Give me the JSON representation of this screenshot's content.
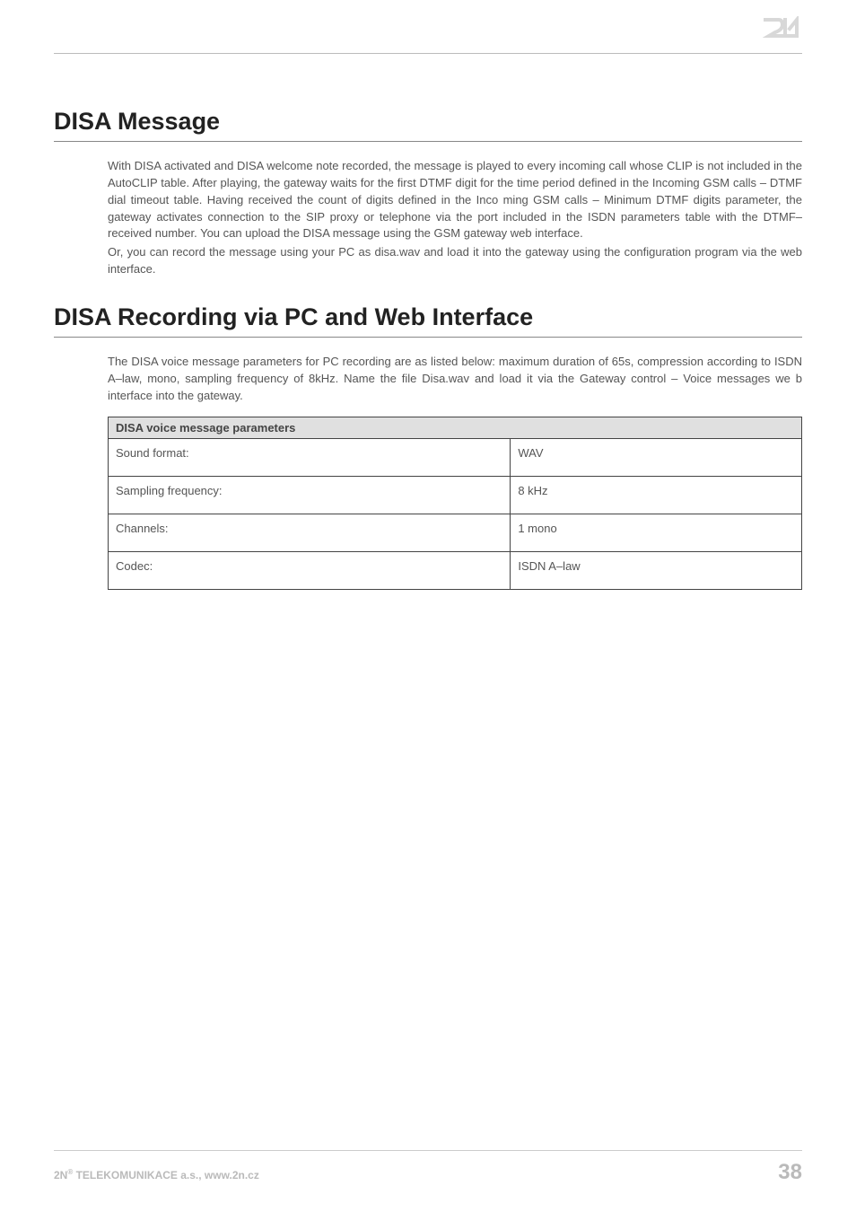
{
  "sections": {
    "disa_message": {
      "heading": "DISA Message",
      "paragraph1": "With DISA activated and DISA welcome note recorded, the message is played to every incoming call whose CLIP is not included in the AutoCLIP table. After playing, the gateway waits for the first DTMF digit for the time period defined in the Incoming GSM calls – DTMF dial timeout table. Having received the count of digits defined in the Inco ming GSM calls – Minimum DTMF digits parameter, the gateway activates connection to the SIP proxy or telephone via the port included in the ISDN parameters table with the DTMF–received number. You can upload the DISA message using the GSM gateway web interface.",
      "paragraph2": "Or, you can record the message using your PC as disa.wav and load it into the gateway using the configuration program via the web interface."
    },
    "disa_recording": {
      "heading": "DISA Recording via PC and Web Interface",
      "paragraph1": "The DISA voice message parameters for PC recording are as listed below: maximum duration of 65s, compression according to ISDN A–law, mono, sampling frequency of 8kHz. Name the file Disa.wav and load it via the Gateway control – Voice messages we b interface into the gateway."
    }
  },
  "table": {
    "header": "DISA voice message parameters",
    "rows": [
      {
        "label": "Sound format:",
        "value": "WAV"
      },
      {
        "label": "Sampling frequency:",
        "value": "8 kHz"
      },
      {
        "label": "Channels:",
        "value": "1 mono"
      },
      {
        "label": "Codec:",
        "value": "ISDN A–law"
      }
    ]
  },
  "footer": {
    "company_prefix": "2N",
    "reg_mark": "®",
    "company_suffix": " TELEKOMUNIKACE a.s., www.2n.cz",
    "page_number": "38"
  }
}
